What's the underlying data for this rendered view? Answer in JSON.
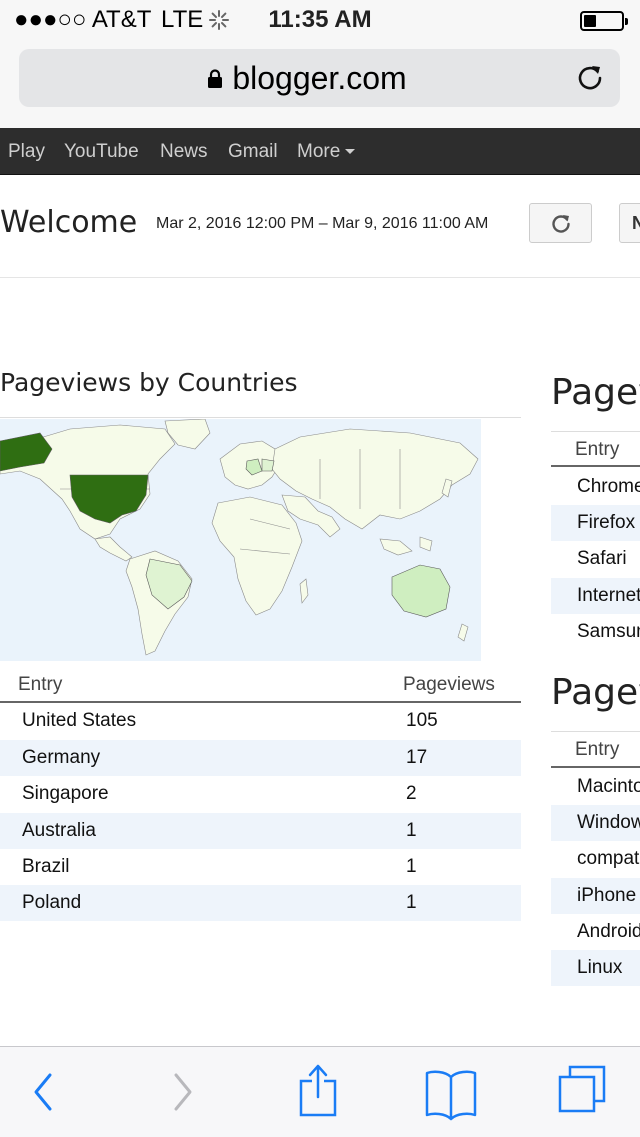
{
  "status": {
    "carrier": "●●●○○ AT&T",
    "network": "LTE",
    "time": "11:35 AM"
  },
  "browser": {
    "url": "blogger.com"
  },
  "gbar": {
    "items": [
      "Play",
      "YouTube",
      "News",
      "Gmail",
      "More"
    ]
  },
  "header": {
    "welcome": "Welcome 2",
    "date_range": "Mar 2, 2016 12:00 PM – Mar 9, 2016 11:00 AM",
    "next_label": "N"
  },
  "countries": {
    "title": "Pageviews by Countries",
    "col_entry": "Entry",
    "col_pageviews": "Pageviews",
    "rows": [
      {
        "entry": "United States",
        "pageviews": "105"
      },
      {
        "entry": "Germany",
        "pageviews": "17"
      },
      {
        "entry": "Singapore",
        "pageviews": "2"
      },
      {
        "entry": "Australia",
        "pageviews": "1"
      },
      {
        "entry": "Brazil",
        "pageviews": "1"
      },
      {
        "entry": "Poland",
        "pageviews": "1"
      }
    ]
  },
  "browsers": {
    "title": "Pageviews by Browsers",
    "col_entry": "Entry",
    "rows": [
      "Chrome",
      "Firefox",
      "Safari",
      "Internet Explorer",
      "Samsung"
    ]
  },
  "os": {
    "title": "Pageviews by Operating Systems",
    "col_entry": "Entry",
    "rows": [
      "Macintosh",
      "Windows",
      "compatible",
      "iPhone",
      "Android",
      "Linux"
    ]
  },
  "colors": {
    "map_ocean": "#eaf3fb",
    "map_land": "#f6fbe9",
    "map_top": "#2f6e12",
    "map_low": "#cfeec0",
    "ios_blue": "#1a7cf5"
  }
}
